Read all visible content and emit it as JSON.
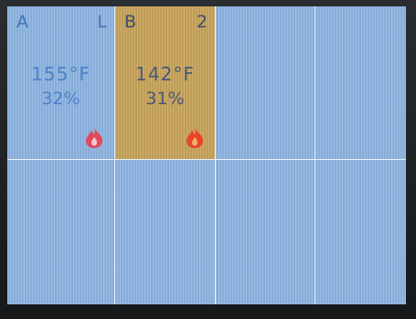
{
  "zones": [
    {
      "name": "A",
      "tag": "L",
      "temperature": "155°F",
      "humidity": "32%",
      "status_icon": "flame-icon",
      "icon_color": "#e24a5c",
      "active": false
    },
    {
      "name": "B",
      "tag": "2",
      "temperature": "142°F",
      "humidity": "31%",
      "status_icon": "flame-icon",
      "icon_color": "#e8452a",
      "active": true
    }
  ],
  "colors": {
    "screen_background": "#8fb6e3",
    "active_zone_background": "#cba75e",
    "grid_line": "#e9f2fb",
    "text": "#4e83c8"
  }
}
